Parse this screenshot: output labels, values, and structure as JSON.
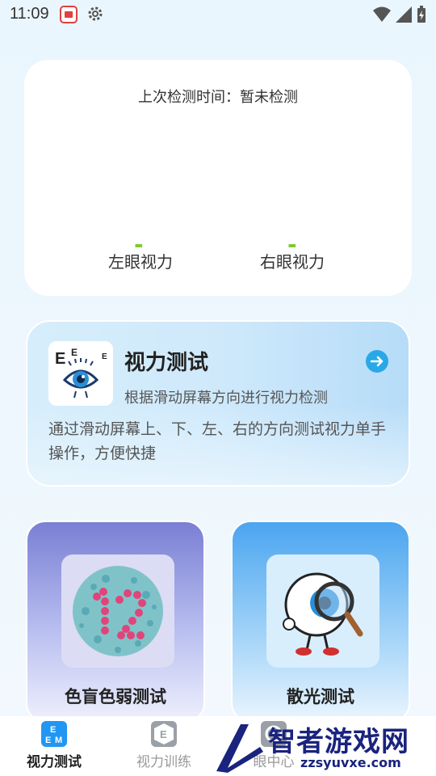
{
  "status_bar": {
    "time": "11:09"
  },
  "summary": {
    "last_check_label": "上次检测时间：暂未检测",
    "left_value": "-",
    "right_value": "-",
    "left_label": "左眼视力",
    "right_label": "右眼视力"
  },
  "feature": {
    "title": "视力测试",
    "subtitle": "根据滑动屏幕方向进行视力检测",
    "description": "通过滑动屏幕上、下、左、右的方向测试视力单手操作，方便快捷"
  },
  "cards": [
    {
      "label": "色盲色弱测试"
    },
    {
      "label": "散光测试"
    }
  ],
  "nav": [
    {
      "label": "视力测试",
      "active": true
    },
    {
      "label": "视力训练",
      "active": false
    },
    {
      "label": "眼中心",
      "active": false
    }
  ],
  "watermark": {
    "title": "智者游戏网",
    "url": "zzsyuvxe.com"
  },
  "colors": {
    "accent_green": "#7ec830",
    "nav_active": "#2196f3",
    "arrow_blue": "#29a8e8"
  }
}
